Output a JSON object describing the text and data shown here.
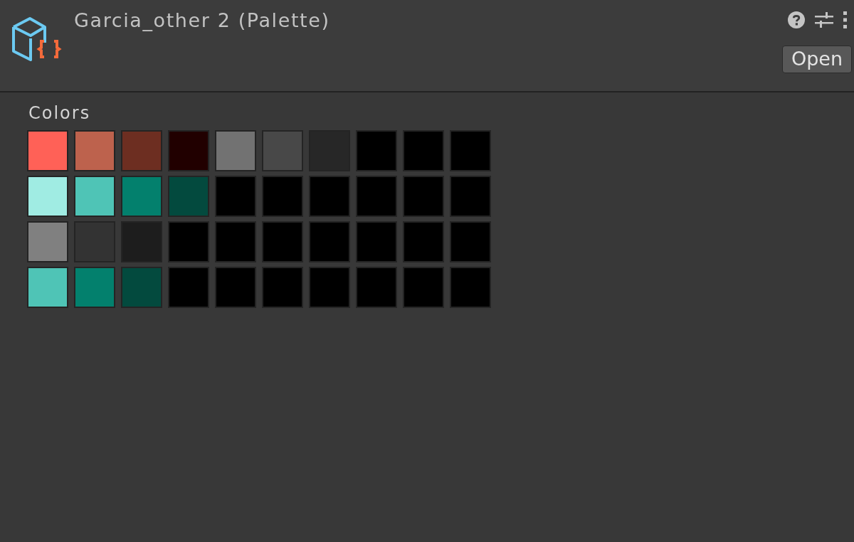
{
  "header": {
    "title": "Garcia_other 2 (Palette)",
    "open_button": "Open"
  },
  "palette": {
    "label": "Colors",
    "rows": [
      {
        "swatches": [
          {
            "color": "#ff6157"
          },
          {
            "color": "#bd624d"
          },
          {
            "color": "#6d2e21"
          },
          {
            "color": "#210000"
          },
          {
            "color": "#727272"
          },
          {
            "color": "#484848"
          },
          {
            "color": "#272727"
          },
          {
            "color": "#000000"
          },
          {
            "color": "#000000"
          },
          {
            "color": "#000000"
          }
        ]
      },
      {
        "swatches": [
          {
            "color": "#a0ece3"
          },
          {
            "color": "#4fc4b6"
          },
          {
            "color": "#03806d"
          },
          {
            "color": "#034a3e"
          },
          {
            "color": "#000000"
          },
          {
            "color": "#000000"
          },
          {
            "color": "#000000"
          },
          {
            "color": "#000000"
          },
          {
            "color": "#000000"
          },
          {
            "color": "#000000"
          }
        ]
      },
      {
        "swatches": [
          {
            "color": "#808080"
          },
          {
            "color": "#333333"
          },
          {
            "color": "#1d1d1d"
          },
          {
            "color": "#000000"
          },
          {
            "color": "#000000"
          },
          {
            "color": "#000000"
          },
          {
            "color": "#000000"
          },
          {
            "color": "#000000"
          },
          {
            "color": "#000000"
          },
          {
            "color": "#000000"
          }
        ]
      },
      {
        "swatches": [
          {
            "color": "#4fc4b6"
          },
          {
            "color": "#03806d"
          },
          {
            "color": "#034a3e"
          },
          {
            "color": "#000000"
          },
          {
            "color": "#000000"
          },
          {
            "color": "#000000"
          },
          {
            "color": "#000000"
          },
          {
            "color": "#000000"
          },
          {
            "color": "#000000"
          },
          {
            "color": "#000000"
          }
        ]
      }
    ]
  }
}
